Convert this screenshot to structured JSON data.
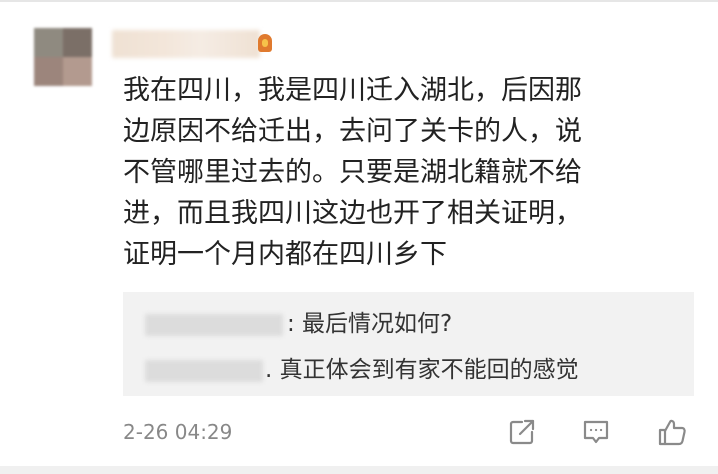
{
  "comment": {
    "lines": [
      "我在四川，我是四川迁入湖北，后因那",
      "边原因不给迁出，去问了关卡的人，说",
      "不管哪里过去的。只要是湖北籍就不给",
      "进，而且我四川这边也开了相关证明，",
      "证明一个月内都在四川乡下"
    ],
    "timestamp": "2-26 04:29"
  },
  "replies": [
    {
      "text": ": 最后情况如何?"
    },
    {
      "text": ". 真正体会到有家不能回的感觉"
    }
  ],
  "icons": {
    "badge": "user-badge-icon",
    "share": "share-icon",
    "comment": "comment-icon",
    "like": "like-icon"
  },
  "colors": {
    "text": "#222222",
    "secondary_text": "#888888",
    "reply_background": "#f2f2f2",
    "icon": "#8a8a8a"
  }
}
